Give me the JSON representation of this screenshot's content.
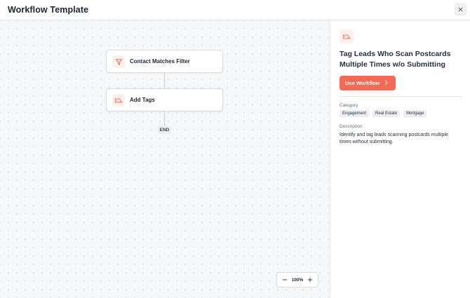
{
  "header": {
    "title": "Workflow Template",
    "close_icon": "close-icon"
  },
  "canvas": {
    "nodes": [
      {
        "label": "Contact Matches Filter",
        "icon": "funnel-icon"
      },
      {
        "label": "Add Tags",
        "icon": "tag-icon"
      }
    ],
    "end_label": "END",
    "zoom": {
      "level": "100%",
      "zoom_out_icon": "minus-icon",
      "zoom_in_icon": "plus-icon"
    }
  },
  "panel": {
    "icon": "tag-icon",
    "title": "Tag Leads Who Scan Postcards Multiple Times w/o Submitting",
    "use_button_label": "Use Workflow",
    "category_label": "Category",
    "categories": [
      "Engagement",
      "Real Estate",
      "Mortgage"
    ],
    "description_label": "Description",
    "description": "Identify and tag leads scanning postcards multiple times without submitting."
  },
  "colors": {
    "accent": "#f66a55",
    "icon_bg": "#fdf1ee",
    "canvas_bg": "#f6f7f9"
  }
}
